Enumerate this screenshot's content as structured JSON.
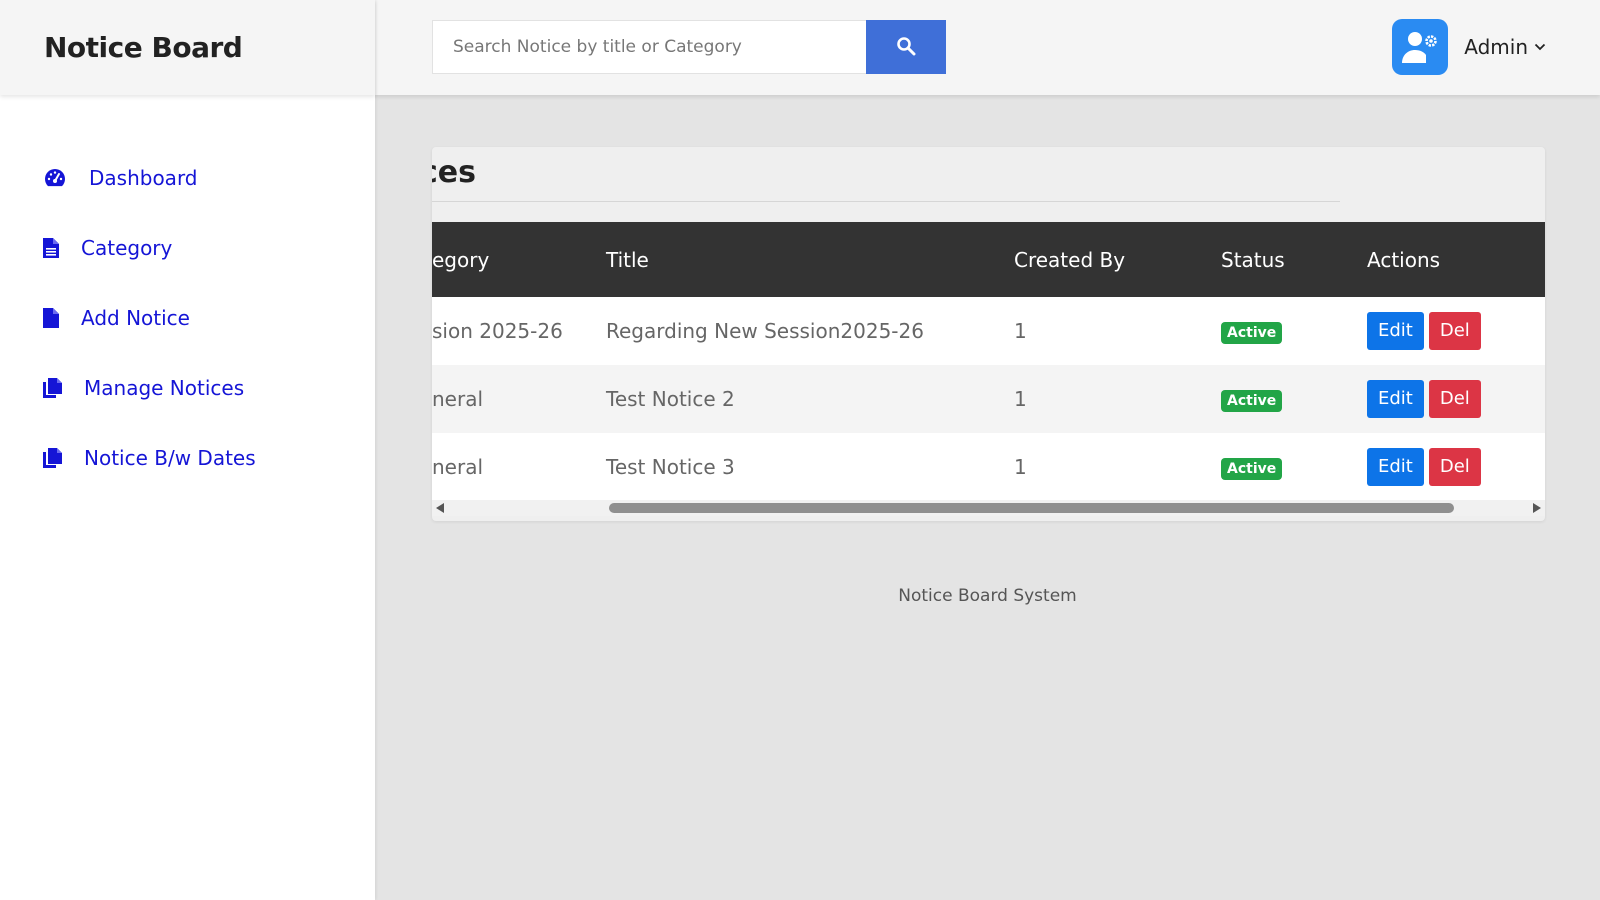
{
  "sidebar": {
    "brand": "Notice Board",
    "items": [
      {
        "label": "Dashboard",
        "icon": "gauge-icon"
      },
      {
        "label": "Category",
        "icon": "file-text-icon"
      },
      {
        "label": "Add Notice",
        "icon": "file-icon"
      },
      {
        "label": "Manage Notices",
        "icon": "copy-icon"
      },
      {
        "label": "Notice B/w Dates",
        "icon": "copy-icon"
      }
    ],
    "link_color": "#1515d6"
  },
  "header": {
    "search_placeholder": "Search Notice by title or Category",
    "search_button_icon": "search-icon",
    "user_name": "Admin",
    "avatar_icon": "user-gear-icon"
  },
  "main": {
    "card_title": "ces",
    "table": {
      "columns": [
        "egory",
        "Title",
        "Created By",
        "Status",
        "Actions"
      ],
      "rows": [
        {
          "category": "sion 2025-26",
          "title": "Regarding New Session2025-26",
          "created_by": "1",
          "status": "Active"
        },
        {
          "category": "neral",
          "title": "Test Notice 2",
          "created_by": "1",
          "status": "Active"
        },
        {
          "category": "neral",
          "title": "Test Notice 3",
          "created_by": "1",
          "status": "Active"
        }
      ],
      "edit_label": "Edit",
      "delete_label": "Del"
    }
  },
  "footer": {
    "text": "Notice Board System"
  },
  "colors": {
    "search_button": "#3f6fd8",
    "avatar_bg": "#2a8bf2",
    "table_header": "#333333",
    "active_badge": "#22a547",
    "edit_button": "#0d74e8",
    "delete_button": "#dc3545"
  }
}
